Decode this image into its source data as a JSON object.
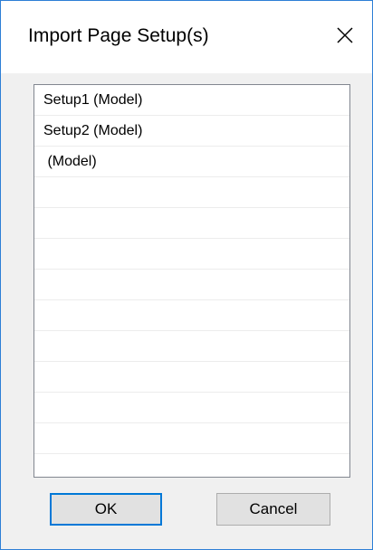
{
  "dialog": {
    "title": "Import Page Setup(s)",
    "close_icon": "close-icon"
  },
  "list": {
    "items": [
      {
        "label": "Setup1 (Model)"
      },
      {
        "label": "Setup2 (Model)"
      },
      {
        "label": " (Model)"
      },
      {
        "label": ""
      },
      {
        "label": ""
      },
      {
        "label": ""
      },
      {
        "label": ""
      },
      {
        "label": ""
      },
      {
        "label": ""
      },
      {
        "label": ""
      },
      {
        "label": ""
      },
      {
        "label": ""
      },
      {
        "label": ""
      }
    ]
  },
  "buttons": {
    "ok_label": "OK",
    "cancel_label": "Cancel"
  },
  "colors": {
    "window_border": "#2d7fd6",
    "dialog_bg": "#f0f0f0",
    "default_button_border": "#0078d7"
  }
}
